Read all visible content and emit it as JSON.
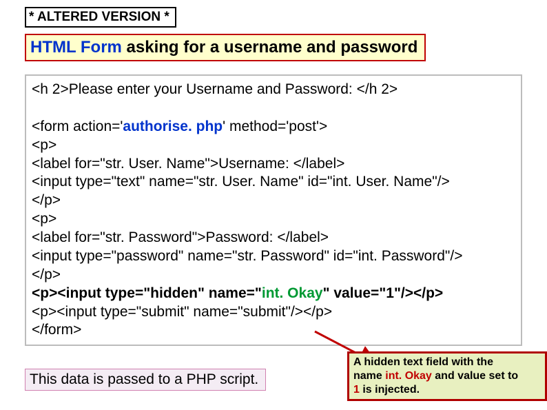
{
  "altered": "* ALTERED VERSION *",
  "title": {
    "html_form": "HTML Form",
    "rest": " asking for a username and password"
  },
  "code": {
    "l1": "<h 2>Please enter your Username and Password: </h 2>",
    "l3_a": "<form action='",
    "l3_b": "authorise. php",
    "l3_c": "' method='post'>",
    "l4": "<p>",
    "l5": "<label for=\"str. User. Name\">Username: </label>",
    "l6": "<input type=\"text\" name=\"str. User. Name\" id=\"int. User. Name\"/>",
    "l7": "</p>",
    "l8": "<p>",
    "l9": "<label for=\"str. Password\">Password: </label>",
    "l10": "<input type=\"password\" name=\"str. Password\" id=\"int. Password\"/>",
    "l11": "</p>",
    "l12_a": "<p><input type=\"hidden\" name=\"",
    "l12_b": "int. Okay",
    "l12_c": "\" value=\"1\"/></p>",
    "l13": "<p><input type=\"submit\" name=\"submit\"/></p>",
    "l14": "</form>"
  },
  "passed": "This data is passed to a PHP script.",
  "callout": {
    "t1": "A hidden text field with the",
    "t2a": "name ",
    "t2b": "int. Okay",
    "t2c": " and value set to",
    "t3a": "1",
    "t3b": " is injected."
  }
}
